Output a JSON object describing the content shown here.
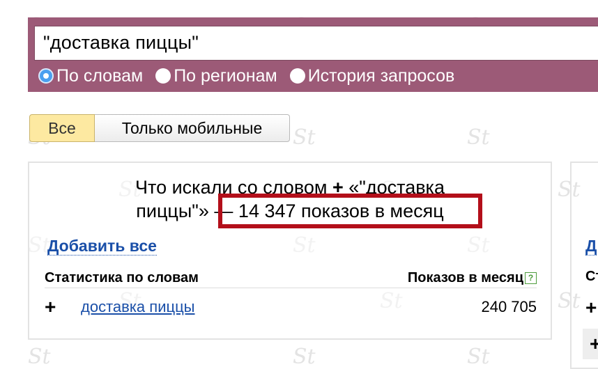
{
  "search": {
    "query": "\"доставка пиццы\"",
    "modes": [
      {
        "label": "По словам",
        "selected": true
      },
      {
        "label": "По регионам",
        "selected": false
      },
      {
        "label": "История запросов",
        "selected": false
      }
    ]
  },
  "device_toggle": {
    "all_label": "Все",
    "mobile_label": "Только мобильные",
    "active": "all"
  },
  "panel": {
    "headline_part1": "Что искали со словом",
    "plus_sign": "+",
    "headline_part2": "«\"доставка",
    "headline_part3": "пиццы\"» —",
    "impressions_text": "14 347 показов в месяц",
    "add_all_label": "Добавить все",
    "col_stats_label": "Статистика по словам",
    "col_impressions_label": "Показов в месяц",
    "help_glyph": "?",
    "rows": [
      {
        "add_glyph": "+",
        "keyword": "доставка пиццы",
        "impressions": "240 705"
      }
    ]
  },
  "right_panel": {
    "cut_letters": [
      "Д",
      "Ст"
    ],
    "plus_glyphs": [
      "+",
      "+"
    ]
  },
  "watermark": "St",
  "colors": {
    "search_band": "#9c5a77",
    "active_toggle": "#fde9a1",
    "link": "#1a4fa8",
    "highlight_border": "#b30f1a",
    "radio_selected": "#4a9ff0"
  }
}
